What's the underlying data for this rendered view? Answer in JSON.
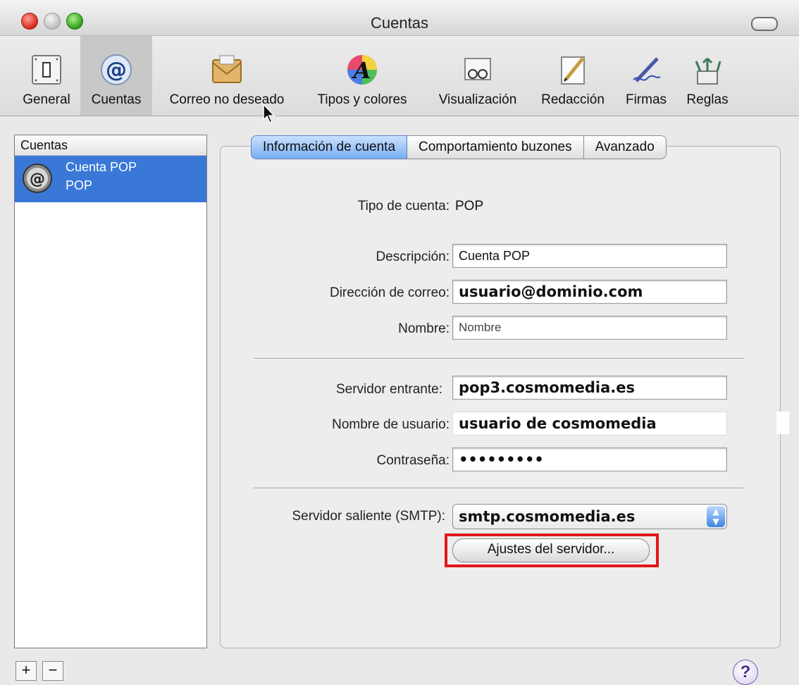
{
  "window": {
    "title": "Cuentas"
  },
  "toolbar": {
    "items": [
      {
        "label": "General",
        "icon": "switch-icon"
      },
      {
        "label": "Cuentas",
        "icon": "at-icon",
        "selected": true
      },
      {
        "label": "Correo no deseado",
        "icon": "junk-mail-icon"
      },
      {
        "label": "Tipos y colores",
        "icon": "fonts-colors-icon"
      },
      {
        "label": "Visualización",
        "icon": "viewing-glasses-icon"
      },
      {
        "label": "Redacción",
        "icon": "compose-pencil-icon"
      },
      {
        "label": "Firmas",
        "icon": "signature-pen-icon"
      },
      {
        "label": "Reglas",
        "icon": "rules-arrows-icon"
      }
    ]
  },
  "sidebar": {
    "header": "Cuentas",
    "accounts": [
      {
        "name": "Cuenta POP",
        "type": "POP"
      }
    ],
    "add_label": "+",
    "remove_label": "−"
  },
  "tabs": [
    {
      "label": "Información de cuenta",
      "active": true
    },
    {
      "label": "Comportamiento buzones",
      "active": false
    },
    {
      "label": "Avanzado",
      "active": false
    }
  ],
  "form": {
    "account_type_label": "Tipo de cuenta:",
    "account_type_value": "POP",
    "description_label": "Descripción:",
    "description_value": "Cuenta POP",
    "email_label": "Dirección de correo:",
    "email_value": "usuario@dominio.com",
    "name_label": "Nombre:",
    "name_value": "Nombre",
    "incoming_label": "Servidor entrante:",
    "incoming_value": "pop3.cosmomedia.es",
    "username_label": "Nombre de usuario:",
    "username_value": "usuario de cosmomedia",
    "password_label": "Contraseña:",
    "password_value": "•••••••••",
    "smtp_label": "Servidor saliente (SMTP):",
    "smtp_value": "smtp.cosmomedia.es",
    "server_settings_button": "Ajustes del servidor..."
  },
  "help_label": "?",
  "colors": {
    "selection": "#3a78d8",
    "highlight_box": "#e01919",
    "active_tab": "#78aef0"
  }
}
